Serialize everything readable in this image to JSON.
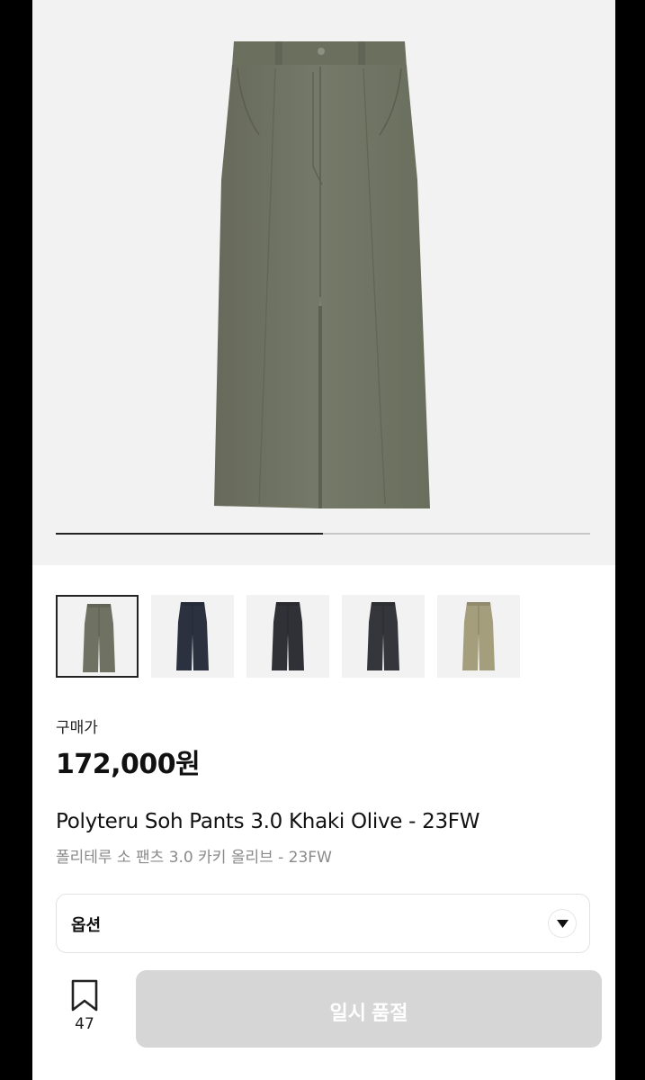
{
  "product": {
    "progress": 0.5,
    "thumbnails": [
      {
        "name": "thumb-khaki-olive",
        "color": "#6f7262",
        "selected": true
      },
      {
        "name": "thumb-navy",
        "color": "#2c3140",
        "selected": false
      },
      {
        "name": "thumb-charcoal",
        "color": "#2f3136",
        "selected": false
      },
      {
        "name": "thumb-black",
        "color": "#34363b",
        "selected": false
      },
      {
        "name": "thumb-beige",
        "color": "#a59e7d",
        "selected": false
      }
    ],
    "price_label": "구매가",
    "price": "172,000원",
    "title_en": "Polyteru Soh Pants 3.0 Khaki Olive - 23FW",
    "title_ko": "폴리테루 소 팬츠 3.0 카키 올리브 - 23FW"
  },
  "option": {
    "label": "옵션",
    "icon": "chevron-down-icon"
  },
  "footer": {
    "bookmark_icon": "bookmark-icon",
    "bookmark_count": "47",
    "soldout_label": "일시 품절"
  },
  "colors": {
    "pants_main": "#707463",
    "background": "#f2f2f2",
    "button_disabled": "#d6d6d6"
  }
}
